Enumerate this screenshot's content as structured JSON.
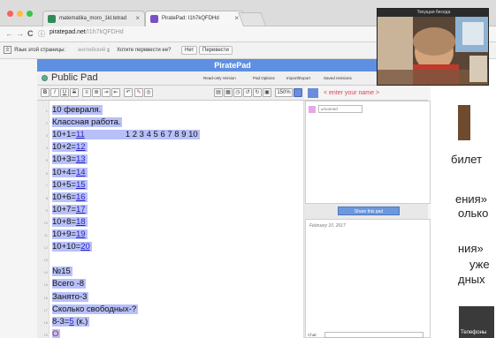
{
  "browser": {
    "tabs": [
      {
        "title": "matematika_moro_1kl.tetrad",
        "close": "×"
      },
      {
        "title": "PiratePad: I1h7kQFDHd",
        "close": "×"
      }
    ],
    "url_host": "piratepad.net",
    "url_path": "/I1h7kQFDHd",
    "nav_back": "←",
    "nav_forward": "→",
    "nav_reload": "C",
    "info_icon": "ⓘ"
  },
  "translate_bar": {
    "prompt": "Язык этой страницы:",
    "language": "английский",
    "question": "Хотите перевести ее?",
    "no_label": "Нет",
    "translate_label": "Перевести"
  },
  "video_overlay": {
    "title": "Текущая беседа"
  },
  "piratepad": {
    "header": "PiratePad",
    "pad_title": "Public Pad",
    "options": [
      "Read-only Version",
      "Pad Options",
      "Import/Export",
      "Saved revisions"
    ],
    "toolbar": {
      "bold": "B",
      "italic": "I",
      "underline": "U",
      "strike": "S",
      "zoom": "150%"
    },
    "lines": [
      {
        "num": "1",
        "text": "10 февраля."
      },
      {
        "num": "2",
        "text": "Классная работа."
      },
      {
        "num": "3",
        "expr": "10+1=",
        "ans": "11",
        "nums": "1 2 3 4 5 6 7 8 9 10"
      },
      {
        "num": "4",
        "expr": "10+2=",
        "ans": "12"
      },
      {
        "num": "5",
        "expr": "10+3=",
        "ans": "13"
      },
      {
        "num": "6",
        "expr": "10+4=",
        "ans": "14"
      },
      {
        "num": "7",
        "expr": "10+5=",
        "ans": "15"
      },
      {
        "num": "8",
        "expr": "10+6=",
        "ans": "16"
      },
      {
        "num": "9",
        "expr": "10+7=",
        "ans": "17"
      },
      {
        "num": "10",
        "expr": "10+8=",
        "ans": "18"
      },
      {
        "num": "11",
        "expr": "10+9=",
        "ans": "19"
      },
      {
        "num": "12",
        "expr": "10+10=",
        "ans": "20"
      },
      {
        "num": "13",
        "text": ""
      },
      {
        "num": "14",
        "text": "№15"
      },
      {
        "num": "15",
        "text": "Всего -8"
      },
      {
        "num": "16",
        "text": "Занято-3"
      },
      {
        "num": "17",
        "text": "Сколько свободных-?"
      },
      {
        "num": "18",
        "expr": "8-3=",
        "ans": "5",
        "suffix": " (к.)"
      },
      {
        "num": "19",
        "text": "О"
      }
    ],
    "sidebar": {
      "name_placeholder": "< enter your name >",
      "unnamed": "unnamed",
      "share_label": "Share this pad",
      "chat_date": "February 10, 2017",
      "chat_label": "Chat:"
    }
  },
  "background_page": {
    "lines": [
      "билет",
      "ения»",
      "олько",
      "ния»",
      "уже",
      "дных"
    ],
    "footer": "Телефоны"
  },
  "colors": {
    "pad_header": "#5e8fe0",
    "highlight": "#b7c0f8",
    "answer": "#2a22c8",
    "accent_red": "#d5131d"
  }
}
